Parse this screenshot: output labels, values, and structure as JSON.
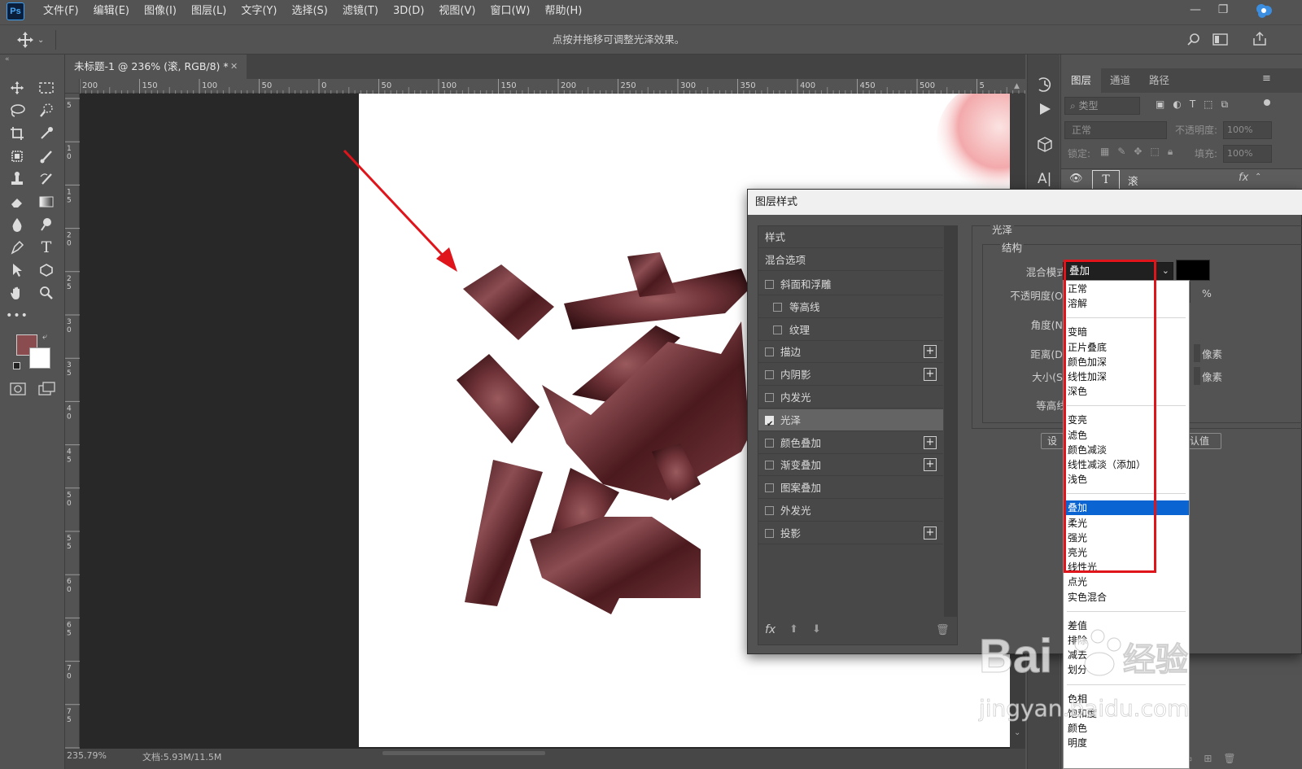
{
  "app": {
    "logo": "Ps",
    "menu": [
      "文件(F)",
      "编辑(E)",
      "图像(I)",
      "图层(L)",
      "文字(Y)",
      "选择(S)",
      "滤镜(T)",
      "3D(D)",
      "视图(V)",
      "窗口(W)",
      "帮助(H)"
    ]
  },
  "options_bar": {
    "hint": "点按并拖移可调整光泽效果。"
  },
  "document": {
    "tab_title": "未标题-1 @ 236% (滚, RGB/8) *",
    "ruler_top": [
      "200",
      "150",
      "100",
      "50",
      "0",
      "50",
      "100",
      "150",
      "200",
      "250",
      "300",
      "350",
      "400",
      "450",
      "500",
      "5"
    ],
    "ruler_left": [
      "5",
      "1 0",
      "1 5",
      "2 0",
      "2 5",
      "3 0",
      "3 5",
      "4 0",
      "4 5",
      "5 0",
      "5 5",
      "6 0",
      "6 5",
      "7 0",
      "7 5",
      "8"
    ],
    "canvas_text": "滚",
    "status_zoom": "235.79%",
    "status_doc": "文档:5.93M/11.5M",
    "foreground_color": "#8b4c50",
    "background_color": "#ffffff"
  },
  "layers_panel": {
    "tabs": [
      "图层",
      "通道",
      "路径"
    ],
    "filter_placeholder": "类型",
    "blend_mode": "正常",
    "opacity_label": "不透明度:",
    "opacity_value": "100%",
    "lock_label": "锁定:",
    "fill_label": "填充:",
    "fill_value": "100%",
    "layer_name": "滚",
    "fx_label": "fx"
  },
  "dialog": {
    "title": "图层样式",
    "styles_header": "样式",
    "blend_options": "混合选项",
    "styles": [
      {
        "label": "斜面和浮雕",
        "checked": false,
        "plus": false,
        "indent": false
      },
      {
        "label": "等高线",
        "checked": false,
        "plus": false,
        "indent": true
      },
      {
        "label": "纹理",
        "checked": false,
        "plus": false,
        "indent": true
      },
      {
        "label": "描边",
        "checked": false,
        "plus": true,
        "indent": false
      },
      {
        "label": "内阴影",
        "checked": false,
        "plus": true,
        "indent": false
      },
      {
        "label": "内发光",
        "checked": false,
        "plus": false,
        "indent": false
      },
      {
        "label": "光泽",
        "checked": true,
        "plus": false,
        "indent": false,
        "selected": true
      },
      {
        "label": "颜色叠加",
        "checked": false,
        "plus": true,
        "indent": false
      },
      {
        "label": "渐变叠加",
        "checked": false,
        "plus": true,
        "indent": false
      },
      {
        "label": "图案叠加",
        "checked": false,
        "plus": false,
        "indent": false
      },
      {
        "label": "外发光",
        "checked": false,
        "plus": false,
        "indent": false
      },
      {
        "label": "投影",
        "checked": false,
        "plus": true,
        "indent": false
      }
    ],
    "fx_label": "fx",
    "section_title": "光泽",
    "group_title": "结构",
    "blend_mode_label": "混合模式:",
    "blend_mode_value": "叠加",
    "opacity_label": "不透明度(O):",
    "percent": "%",
    "angle_label": "角度(N):",
    "distance_label": "距离(D):",
    "size_label": "大小(S):",
    "pixel_unit": "像素",
    "contour_label": "等高线:",
    "btn_set_default": "设",
    "btn_reset_default": "认值",
    "color_swatch": "#000000"
  },
  "blend_dropdown": {
    "groups": [
      [
        "正常",
        "溶解"
      ],
      [
        "变暗",
        "正片叠底",
        "颜色加深",
        "线性加深",
        "深色"
      ],
      [
        "变亮",
        "滤色",
        "颜色减淡",
        "线性减淡（添加）",
        "浅色"
      ],
      [
        "叠加",
        "柔光",
        "强光",
        "亮光",
        "线性光",
        "点光",
        "实色混合"
      ],
      [
        "差值",
        "排除",
        "减去",
        "划分"
      ],
      [
        "色相",
        "饱和度",
        "颜色",
        "明度"
      ]
    ],
    "selected": "叠加"
  },
  "watermark": {
    "brand": "Baidu经验",
    "url": "jingyan.baidu.com"
  },
  "colors": {
    "accent": "#0a64d2",
    "annotation_red": "#e0141b"
  }
}
